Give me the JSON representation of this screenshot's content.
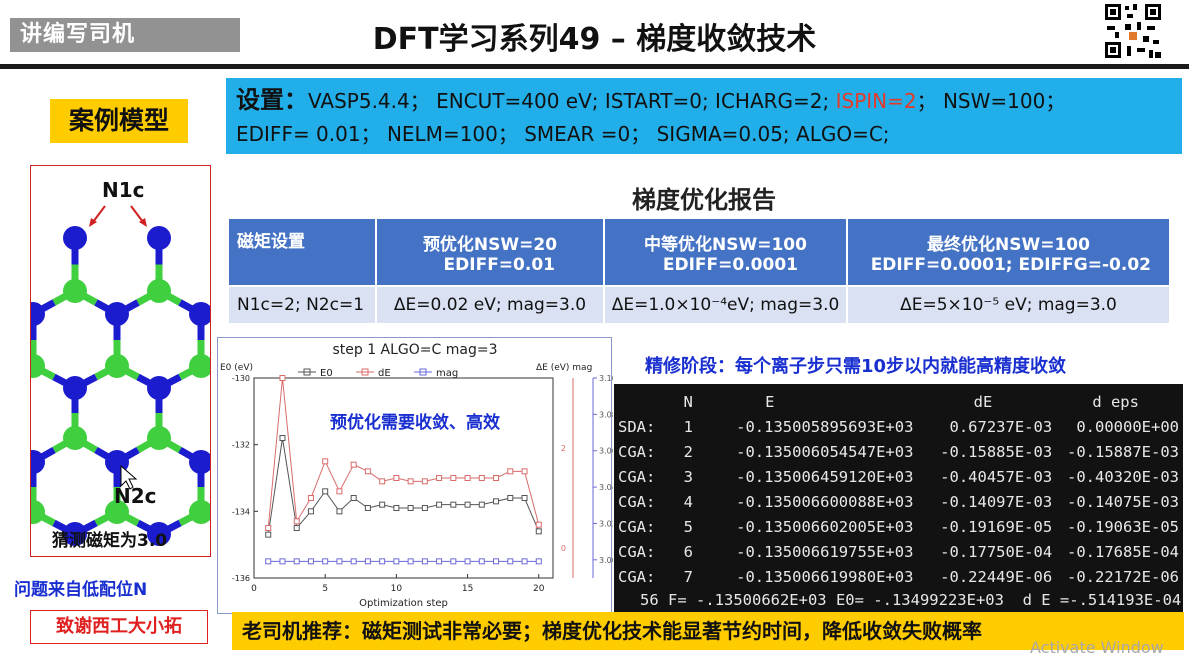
{
  "header": {
    "brand": "讲编写司机",
    "title": "DFT学习系列49 – 梯度收敛技术"
  },
  "settings": {
    "label": "设置：",
    "part1": "VASP5.4.4；  ENCUT=400 eV; ISTART=0; ICHARG=2; ",
    "ispin": "ISPIN=2",
    "part2": "；  NSW=100；",
    "line2": "EDIFF= 0.01；  NELM=100；  SMEAR =0；  SIGMA=0.05; ALGO=C;"
  },
  "case_model": {
    "label": "案例模型",
    "n1c": "N1c",
    "n2c": "N2c",
    "guess": "猜测磁矩为3.0"
  },
  "question": "问题来自低配位N",
  "thanks": "致谢西工大小拓",
  "report": {
    "title": "梯度优化报告",
    "headers": [
      {
        "l1": "磁矩设置",
        "l2": ""
      },
      {
        "l1": "预优化NSW=20",
        "l2": "EDIFF=0.01"
      },
      {
        "l1": "中等优化NSW=100",
        "l2": "EDIFF=0.0001"
      },
      {
        "l1": "最终优化NSW=100",
        "l2": "EDIFF=0.0001; EDIFFG=-0.02"
      }
    ],
    "row": [
      "N1c=2; N2c=1",
      "ΔE=0.02 eV; mag=3.0",
      "ΔE=1.0×10⁻⁴eV; mag=3.0",
      "ΔE=5×10⁻⁵ eV; mag=3.0"
    ]
  },
  "chart_data": {
    "type": "line",
    "title": "step 1 ALGO=C mag=3",
    "xlabel": "Optimization step",
    "ylabel_left": "E0 (eV)",
    "ylabel_right": "ΔE (eV) mag",
    "xlim": [
      0,
      21
    ],
    "ylim_left": [
      -136,
      -130
    ],
    "ylim_right": [
      2.99,
      3.1
    ],
    "x_ticks": [
      "0",
      "5",
      "10",
      "15",
      "20"
    ],
    "y_ticks_left": [
      "-130",
      "-132",
      "-134",
      "-136"
    ],
    "y_ticks_right_de": [
      "0",
      "2"
    ],
    "y_ticks_right_mag": [
      "3.00",
      "3.02",
      "3.04",
      "3.06",
      "3.08",
      "3.10"
    ],
    "annotation": "预优化需要收敛、高效",
    "series": [
      {
        "name": "E0",
        "color": "#555555",
        "x": [
          1,
          2,
          3,
          4,
          5,
          6,
          7,
          8,
          9,
          10,
          11,
          12,
          13,
          14,
          15,
          16,
          17,
          18,
          19,
          20
        ],
        "values": [
          -134.7,
          -131.8,
          -134.5,
          -134.0,
          -133.4,
          -134.0,
          -133.6,
          -133.9,
          -133.8,
          -133.9,
          -133.9,
          -133.9,
          -133.8,
          -133.8,
          -133.8,
          -133.8,
          -133.7,
          -133.6,
          -133.6,
          -134.6
        ]
      },
      {
        "name": "dE",
        "color": "#d96b6b",
        "x": [
          1,
          2,
          3,
          4,
          5,
          6,
          7,
          8,
          9,
          10,
          11,
          12,
          13,
          14,
          15,
          16,
          17,
          18,
          19,
          20
        ],
        "values": [
          -134.5,
          -130.0,
          -134.3,
          -133.6,
          -132.5,
          -133.4,
          -132.6,
          -132.8,
          -133.1,
          -133.0,
          -133.1,
          -133.1,
          -133.0,
          -133.0,
          -133.0,
          -133.0,
          -133.0,
          -132.8,
          -132.8,
          -134.4
        ]
      },
      {
        "name": "mag",
        "color": "#6a6ad8",
        "x": [
          1,
          2,
          3,
          4,
          5,
          6,
          7,
          8,
          9,
          10,
          11,
          12,
          13,
          14,
          15,
          16,
          17,
          18,
          19,
          20
        ],
        "values": [
          -135.5,
          -135.5,
          -135.5,
          -135.5,
          -135.5,
          -135.5,
          -135.5,
          -135.5,
          -135.5,
          -135.5,
          -135.5,
          -135.5,
          -135.5,
          -135.5,
          -135.5,
          -135.5,
          -135.5,
          -135.5,
          -135.5,
          -135.5
        ]
      }
    ]
  },
  "refine": {
    "title": "精修阶段：每个离子步只需10步以内就能高精度收敛",
    "columns": [
      "",
      "N",
      "E",
      "dE",
      "d eps"
    ],
    "rows": [
      [
        "SDA:",
        "1",
        "-0.135005895693E+03",
        "0.67237E-03",
        "0.00000E+00"
      ],
      [
        "CGA:",
        "2",
        "-0.135006054547E+03",
        "-0.15885E-03",
        "-0.15887E-03"
      ],
      [
        "CGA:",
        "3",
        "-0.135006459120E+03",
        "-0.40457E-03",
        "-0.40320E-03"
      ],
      [
        "CGA:",
        "4",
        "-0.135006600088E+03",
        "-0.14097E-03",
        "-0.14075E-03"
      ],
      [
        "CGA:",
        "5",
        "-0.135006602005E+03",
        "-0.19169E-05",
        "-0.19063E-05"
      ],
      [
        "CGA:",
        "6",
        "-0.135006619755E+03",
        "-0.17750E-04",
        "-0.17685E-04"
      ],
      [
        "CGA:",
        "7",
        "-0.135006619980E+03",
        "-0.22449E-06",
        "-0.22172E-06"
      ]
    ],
    "footer": "56 F= -.13500662E+03 E0= -.13499223E+03  d E =-.514193E-04"
  },
  "banner": "老司机推荐：磁矩测试非常必要；梯度优化技术能显著节约时间，降低收敛失败概率",
  "watermark": "Activate Window"
}
